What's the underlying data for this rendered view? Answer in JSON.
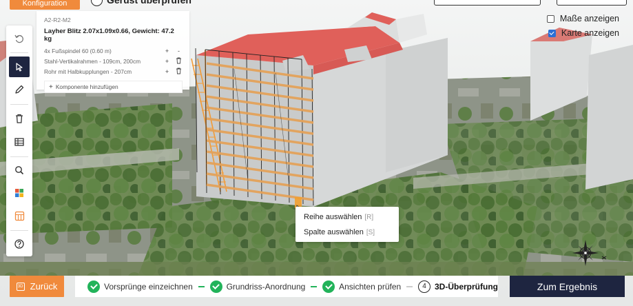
{
  "topbar": {
    "config_label": "Konfiguration",
    "step_title": "Gerüst überprüfen"
  },
  "toggles": [
    {
      "label": "Maße anzeigen",
      "checked": false
    },
    {
      "label": "Karte anzeigen",
      "checked": true
    }
  ],
  "toolbar": {
    "tools": [
      {
        "name": "undo-icon",
        "active": false
      },
      {
        "name": "cursor-icon",
        "active": true
      },
      {
        "name": "pencil-icon",
        "active": false
      },
      {
        "name": "trash-icon",
        "active": false
      },
      {
        "name": "table-icon",
        "active": false
      },
      {
        "name": "search-icon",
        "active": false
      },
      {
        "name": "grid-color-icon",
        "active": false
      },
      {
        "name": "grid-orange-icon",
        "active": false
      },
      {
        "name": "help-icon",
        "active": false
      }
    ]
  },
  "info_panel": {
    "code": "A2-R2-M2",
    "title": "Layher Blitz 2.07x1.09x0.66, Gewicht: 47.2 kg",
    "components": [
      {
        "label": "4x Fußspindel 60 (0.60 m)",
        "actions": [
          "+",
          "-"
        ]
      },
      {
        "label": "Stahl-Vertikalrahmen - 109cm, 200cm",
        "actions": [
          "+",
          "trash"
        ]
      },
      {
        "label": "Rohr mit Halbkupplungen - 207cm",
        "actions": [
          "+",
          "trash"
        ]
      }
    ],
    "add_label": "Komponente hinzufügen"
  },
  "context_menu": {
    "items": [
      {
        "label": "Reihe auswählen",
        "shortcut": "[R]"
      },
      {
        "label": "Spalte auswählen",
        "shortcut": "[S]"
      }
    ]
  },
  "bottom": {
    "back_label": "Zurück",
    "back_icon": "3D",
    "steps": [
      {
        "label": "Vorsprünge einzeichnen",
        "done": true
      },
      {
        "label": "Grundriss-Anordnung",
        "done": true
      },
      {
        "label": "Ansichten prüfen",
        "done": true
      },
      {
        "label": "3D-Überprüfung",
        "done": false,
        "number": "4"
      }
    ],
    "result_label": "Zum Ergebnis"
  },
  "colors": {
    "accent_orange": "#f08a3c",
    "navy": "#1e2540",
    "success_green": "#22b35a",
    "roof_red": "#e0605a"
  }
}
